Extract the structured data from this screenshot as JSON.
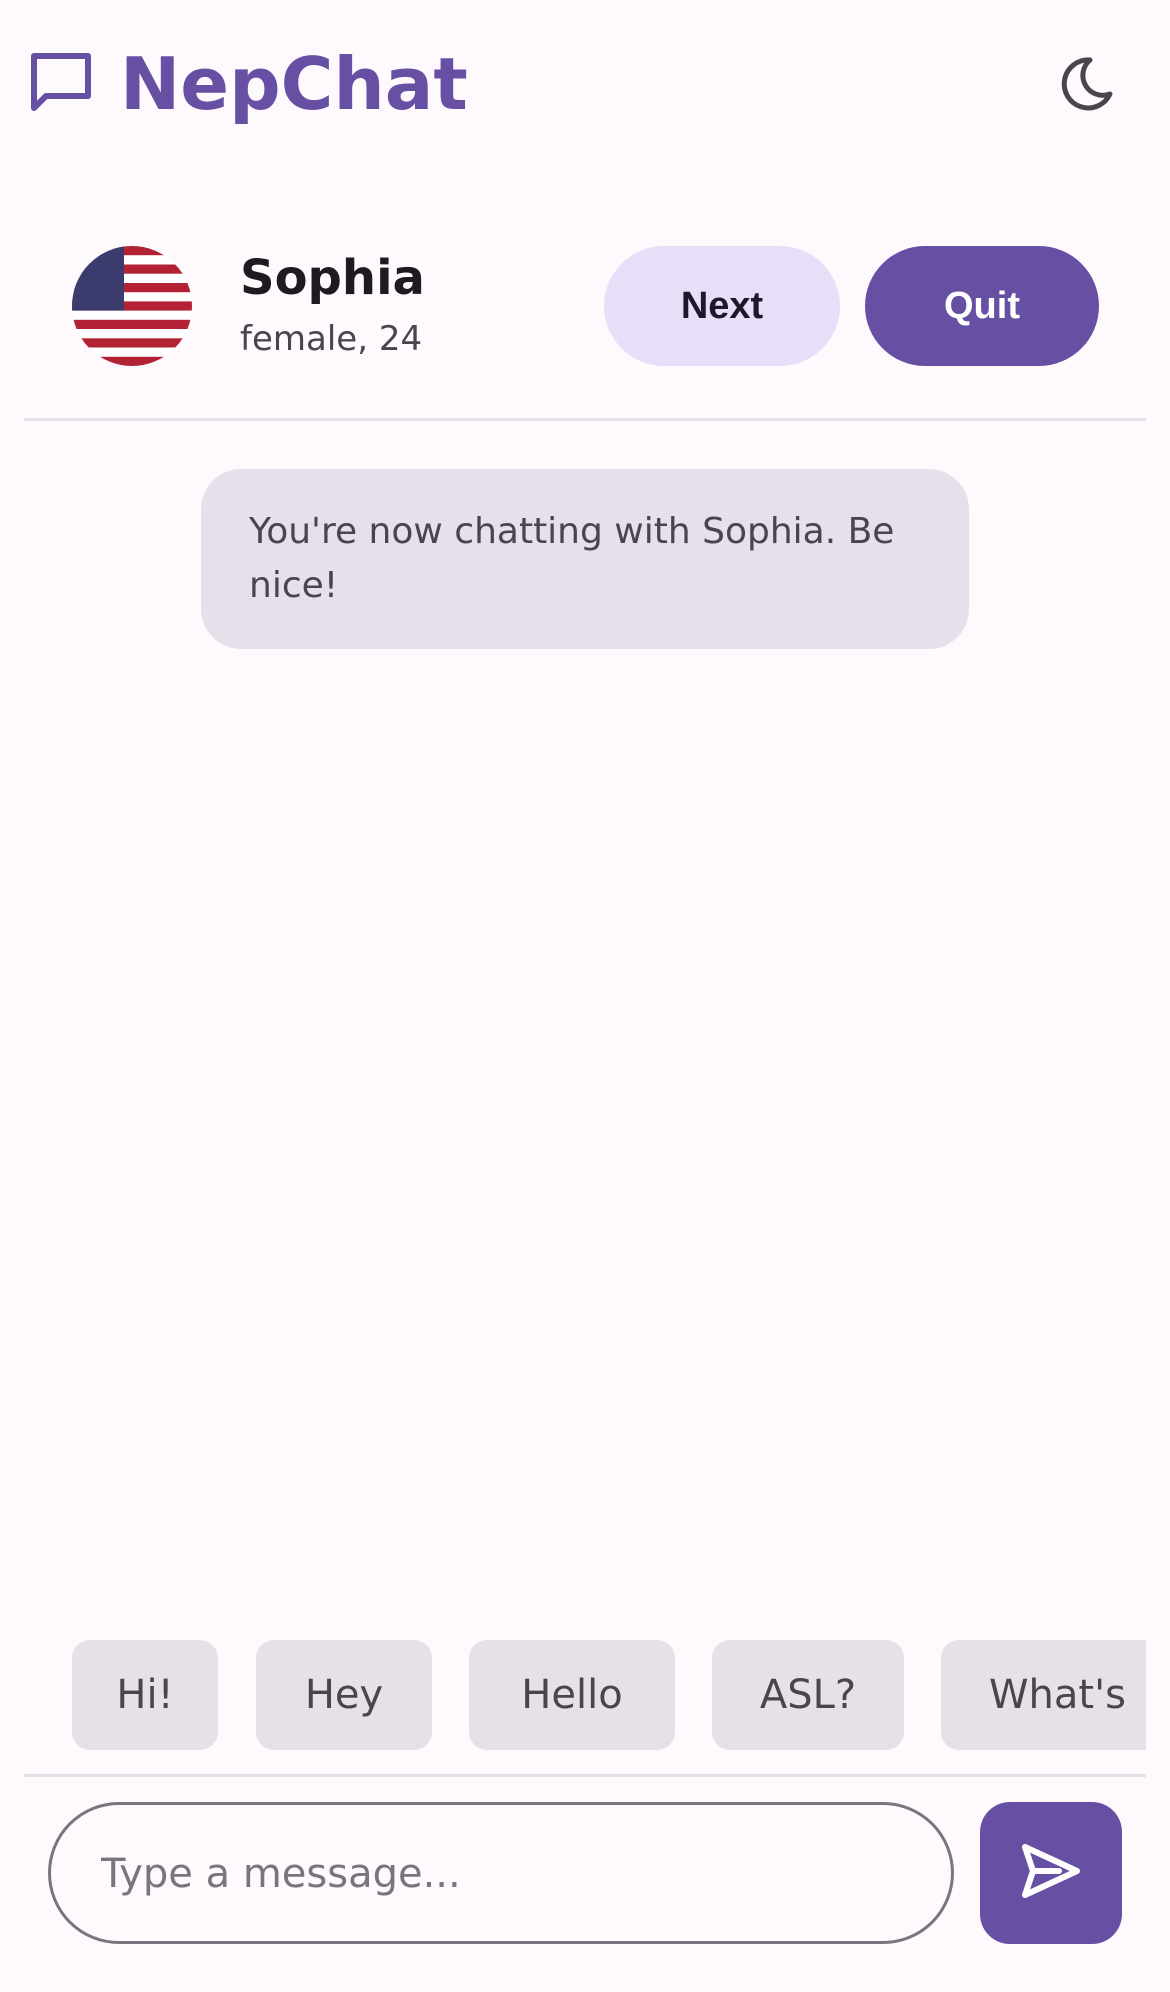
{
  "app": {
    "title": "NepChat",
    "brand_color": "#6750a4",
    "logo_icon": "chat-bubble-icon",
    "theme_icon": "moon-icon"
  },
  "partner": {
    "name": "Sophia",
    "meta": "female, 24",
    "flag_icon": "us-flag-icon",
    "next_label": "Next",
    "quit_label": "Quit"
  },
  "messages": [
    {
      "type": "system",
      "text": "You're now chatting with Sophia. Be nice!"
    }
  ],
  "quick_replies": [
    "Hi!",
    "Hey",
    "Hello",
    "ASL?",
    "What's"
  ],
  "composer": {
    "placeholder": "Type a message...",
    "value": "",
    "send_icon": "send-icon"
  }
}
